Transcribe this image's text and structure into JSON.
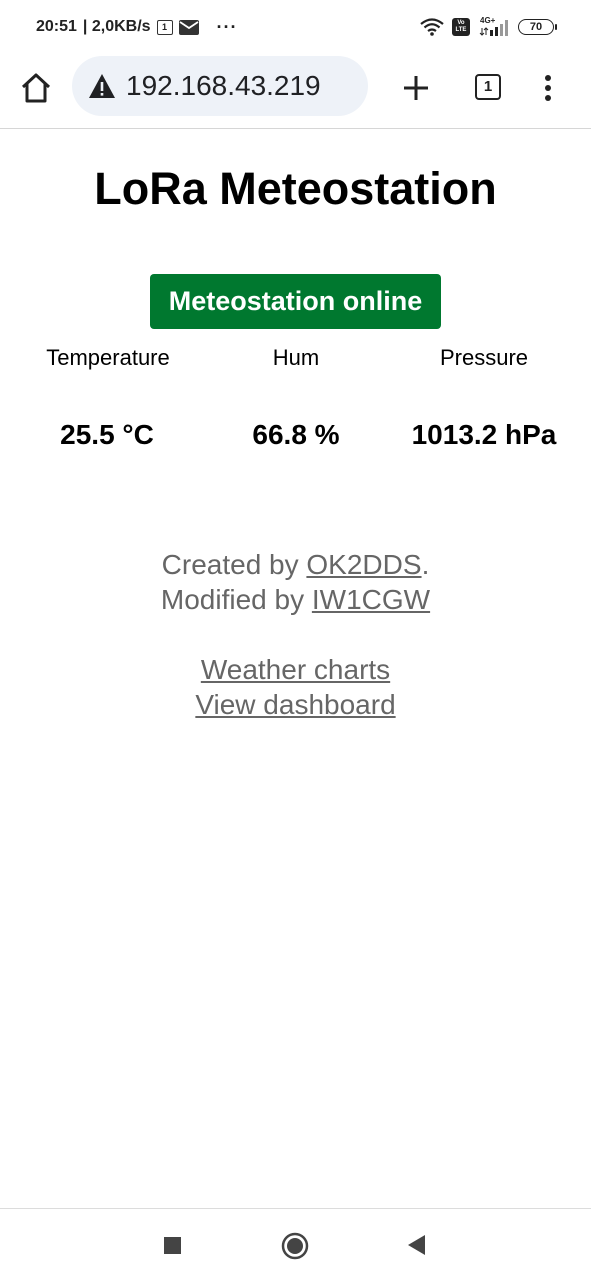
{
  "status_bar": {
    "time": "20:51",
    "speed": "| 2,0KB/s",
    "sim_indicator": "1",
    "notification_dots": "···",
    "network_type": "4G+",
    "volte_top": "Vo",
    "volte_bottom": "LTE",
    "battery": "70"
  },
  "browser": {
    "url": "192.168.43.219",
    "tab_count": "1"
  },
  "page": {
    "title": "LoRa Meteostation",
    "status": "Meteostation online",
    "readings": [
      {
        "label": "Temperature",
        "value": "25.5 °C"
      },
      {
        "label": "Hum",
        "value": "66.8 %"
      },
      {
        "label": "Pressure",
        "value": "1013.2 hPa"
      }
    ],
    "footer": {
      "created_prefix": "Created by ",
      "created_link": "OK2DDS",
      "created_suffix": ".",
      "modified_prefix": "Modified by ",
      "modified_link": "IW1CGW",
      "charts_link": "Weather charts",
      "dashboard_link": "View dashboard"
    }
  },
  "colors": {
    "status_badge_bg": "#00782f",
    "footer_text": "#666666",
    "url_bar_bg": "#eef2f8"
  }
}
